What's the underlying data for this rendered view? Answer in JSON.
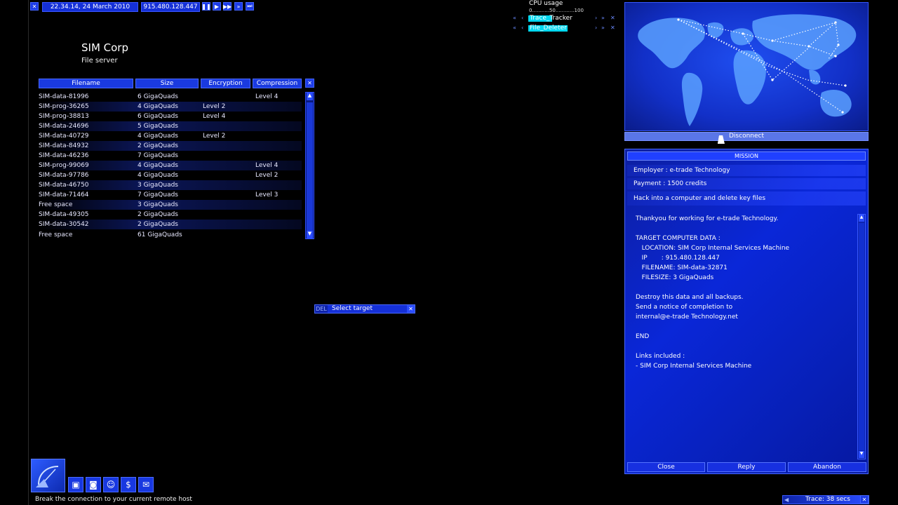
{
  "topbar": {
    "datetime": "22.34.14, 24 March 2010",
    "ip": "915.480.128.447"
  },
  "cpu": {
    "label": "CPU usage",
    "scale": "0...........50............100",
    "tasks": [
      {
        "name": "Trace_Tracker"
      },
      {
        "name": "File_Deleter"
      }
    ]
  },
  "server": {
    "title": "SIM Corp",
    "subtitle": "File server"
  },
  "file_table": {
    "headers": {
      "filename": "Filename",
      "size": "Size",
      "encryption": "Encryption",
      "compression": "Compression"
    },
    "rows": [
      {
        "filename": "SIM-data-81996",
        "size": "6 GigaQuads",
        "encryption": "",
        "compression": "Level 4"
      },
      {
        "filename": "SIM-prog-36265",
        "size": "4 GigaQuads",
        "encryption": "Level 2",
        "compression": ""
      },
      {
        "filename": "SIM-prog-38813",
        "size": "6 GigaQuads",
        "encryption": "Level 4",
        "compression": ""
      },
      {
        "filename": "SIM-data-24696",
        "size": "5 GigaQuads",
        "encryption": "",
        "compression": ""
      },
      {
        "filename": "SIM-data-40729",
        "size": "4 GigaQuads",
        "encryption": "Level 2",
        "compression": ""
      },
      {
        "filename": "SIM-data-84932",
        "size": "2 GigaQuads",
        "encryption": "",
        "compression": ""
      },
      {
        "filename": "SIM-data-46236",
        "size": "7 GigaQuads",
        "encryption": "",
        "compression": ""
      },
      {
        "filename": "SIM-prog-99069",
        "size": "4 GigaQuads",
        "encryption": "",
        "compression": "Level 4"
      },
      {
        "filename": "SIM-data-97786",
        "size": "4 GigaQuads",
        "encryption": "",
        "compression": "Level 2"
      },
      {
        "filename": "SIM-data-46750",
        "size": "3 GigaQuads",
        "encryption": "",
        "compression": ""
      },
      {
        "filename": "SIM-data-71464",
        "size": "7 GigaQuads",
        "encryption": "",
        "compression": "Level 3"
      },
      {
        "filename": "Free space",
        "size": "3 GigaQuads",
        "encryption": "",
        "compression": ""
      },
      {
        "filename": "SIM-data-49305",
        "size": "2 GigaQuads",
        "encryption": "",
        "compression": ""
      },
      {
        "filename": "SIM-data-30542",
        "size": "2 GigaQuads",
        "encryption": "",
        "compression": ""
      },
      {
        "filename": "Free space",
        "size": "61 GigaQuads",
        "encryption": "",
        "compression": ""
      }
    ]
  },
  "select_target": {
    "tag": "DEL",
    "label": "Select target"
  },
  "map": {
    "disconnect_label": "Disconnect"
  },
  "mission": {
    "title": "MISSION",
    "employer": "Employer : e-trade Technology",
    "payment": "Payment : 1500 credits",
    "summary": "Hack into a computer and delete key files",
    "body_lines": [
      "Thankyou for working for e-trade Technology.",
      "",
      "TARGET COMPUTER DATA :",
      "   LOCATION: SIM Corp Internal Services Machine",
      "   IP       : 915.480.128.447",
      "   FILENAME: SIM-data-32871",
      "   FILESIZE: 3 GigaQuads",
      "",
      "Destroy this data and all backups.",
      "Send a notice of completion to",
      "internal@e-trade Technology.net",
      "",
      "END",
      "",
      "Links included :",
      "- SIM Corp Internal Services Machine"
    ],
    "buttons": {
      "close": "Close",
      "reply": "Reply",
      "abandon": "Abandon"
    }
  },
  "status_bar": {
    "tooltip": "Break the connection to your current remote host",
    "trace": "Trace: 38 secs"
  },
  "colors": {
    "accent": "#1a3ae0",
    "highlight": "#00e5ff",
    "background": "#000000"
  }
}
